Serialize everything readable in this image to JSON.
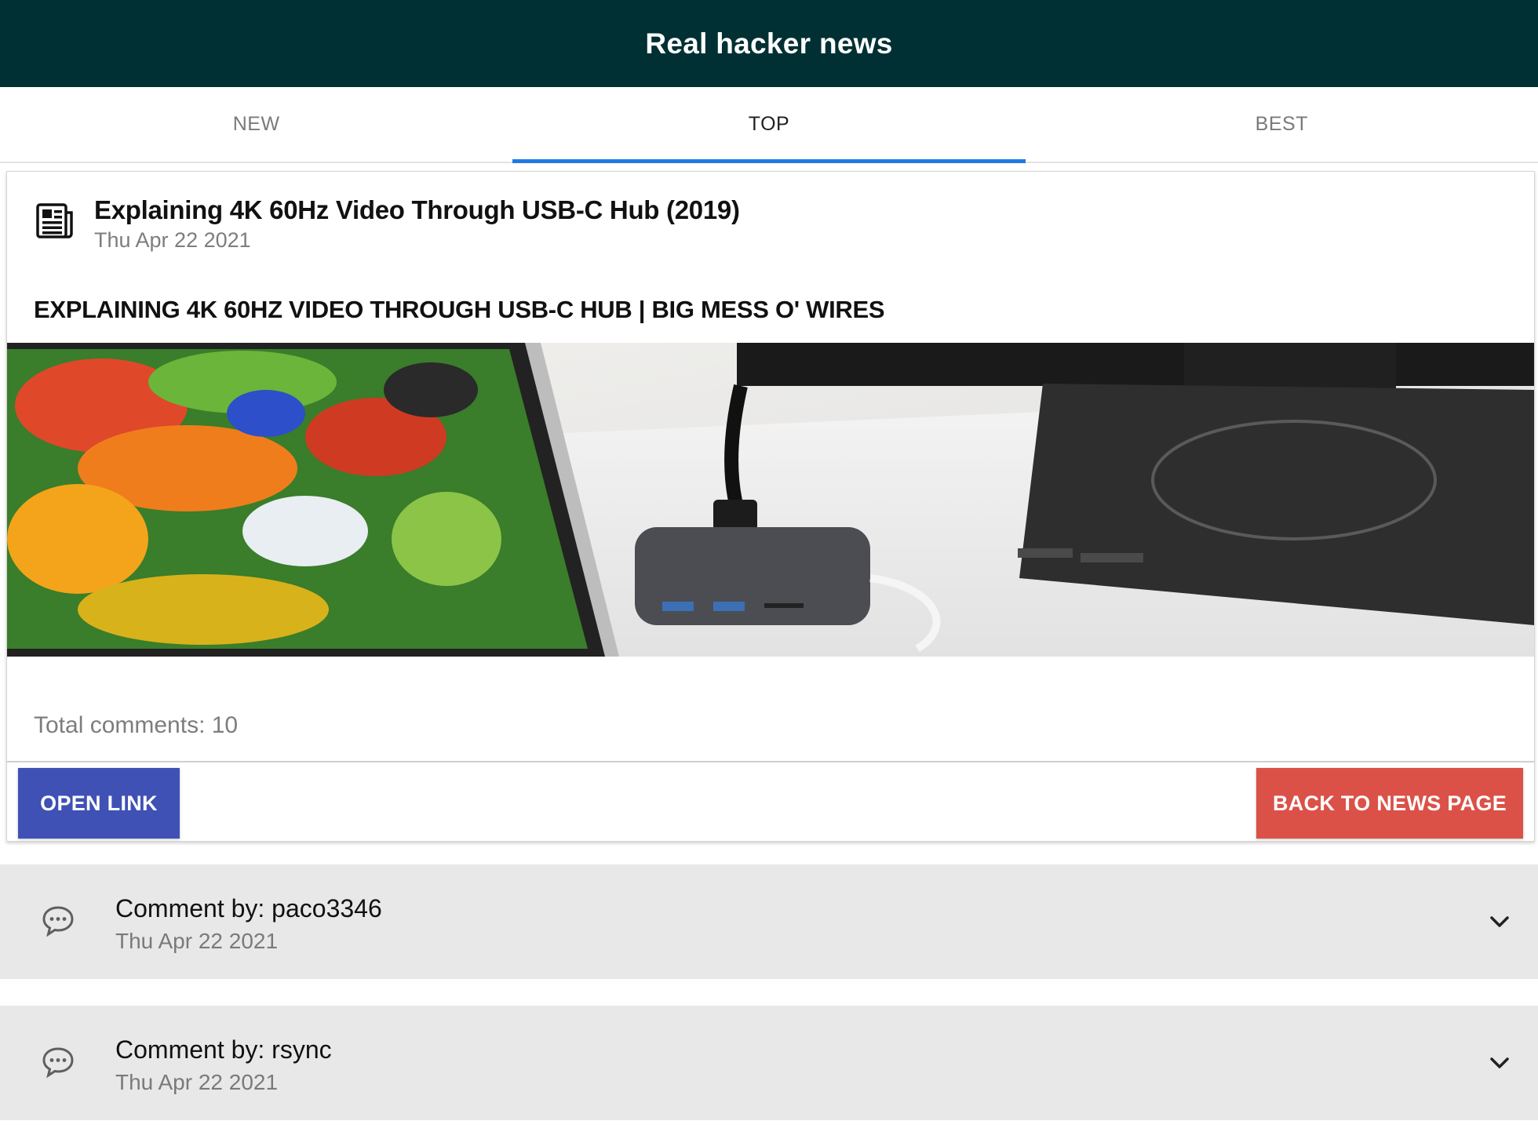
{
  "app": {
    "title": "Real hacker news"
  },
  "tabs": [
    {
      "label": "NEW",
      "active": false
    },
    {
      "label": "TOP",
      "active": true
    },
    {
      "label": "BEST",
      "active": false
    }
  ],
  "story": {
    "icon": "newspaper-icon",
    "title": "Explaining 4K 60Hz Video Through USB-C Hub (2019)",
    "date": "Thu Apr 22 2021",
    "headline": "EXPLAINING 4K 60HZ VIDEO THROUGH USB-C HUB | BIG MESS O' WIRES",
    "image_alt": "Laptop and monitor connected through a USB-C hub",
    "total_comments": "Total comments: 10",
    "open_link_label": "OPEN LINK",
    "back_label": "BACK TO NEWS PAGE"
  },
  "comments": [
    {
      "author": "Comment by: paco3346",
      "date": "Thu Apr 22 2021",
      "icon": "comment-bubble-icon"
    },
    {
      "author": "Comment by: rsync",
      "date": "Thu Apr 22 2021",
      "icon": "comment-bubble-icon"
    }
  ],
  "colors": {
    "appbar": "#003033",
    "tab_indicator": "#1e7ae6",
    "open_button": "#3f51b5",
    "back_button": "#db5148",
    "comment_background": "#e8e8e8"
  }
}
